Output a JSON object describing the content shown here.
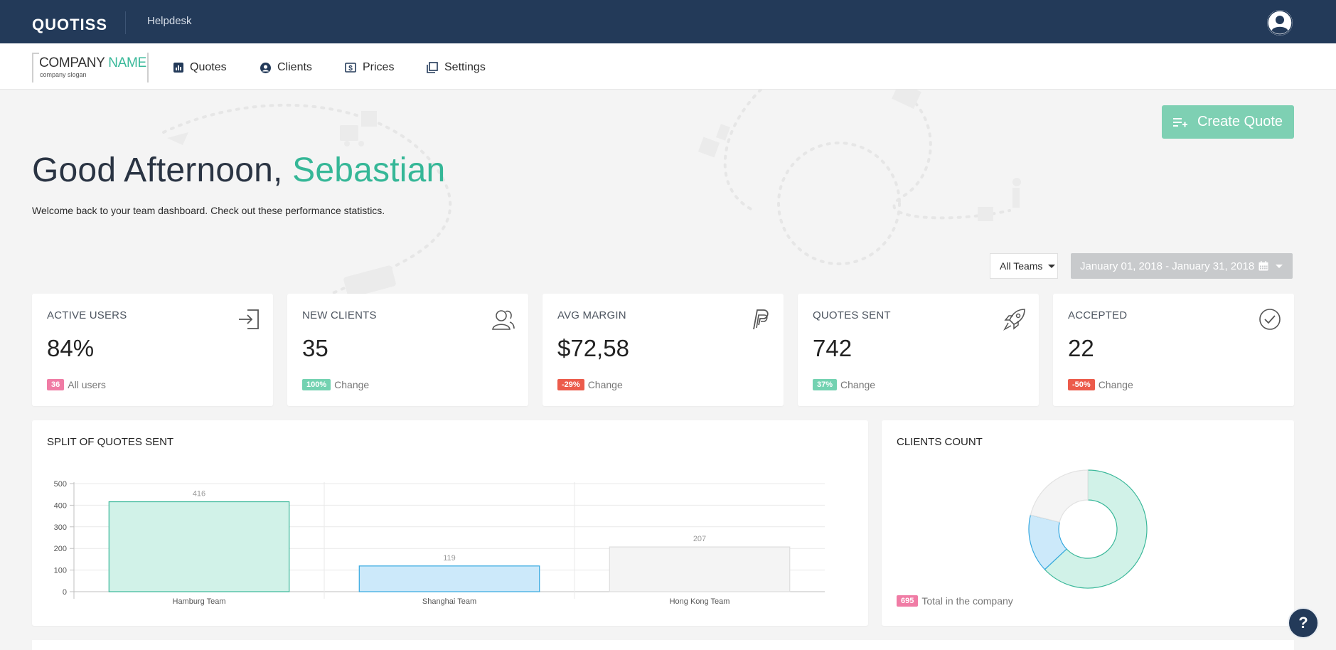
{
  "topbar": {
    "brand": "QUOTISS",
    "helpdesk": "Helpdesk"
  },
  "navbar": {
    "logo_name_part1": "COMPANY ",
    "logo_name_part2": "NAME",
    "logo_slogan": "company slogan",
    "items": [
      {
        "label": "Quotes",
        "icon": "bar-chart-icon"
      },
      {
        "label": "Clients",
        "icon": "user-circle-icon"
      },
      {
        "label": "Prices",
        "icon": "dollar-bill-icon"
      },
      {
        "label": "Settings",
        "icon": "windows-icon"
      }
    ]
  },
  "hero": {
    "create_button": "Create Quote",
    "greeting": "Good Afternoon, ",
    "user_name": "Sebastian",
    "welcome": "Welcome back to your team dashboard. Check out these performance statistics."
  },
  "filters": {
    "teams": "All Teams",
    "date_range": "January 01, 2018 - January 31, 2018"
  },
  "stats": [
    {
      "label": "ACTIVE USERS",
      "value": "84%",
      "badge": "36",
      "badge_color": "#f07ca5",
      "foot": "All users",
      "icon": "sign-in-icon"
    },
    {
      "label": "NEW CLIENTS",
      "value": "35",
      "badge": "100%",
      "badge_color": "#73d2b1",
      "foot": "Change",
      "icon": "users-icon"
    },
    {
      "label": "AVG MARGIN",
      "value": "$72,58",
      "badge": "-29%",
      "badge_color": "#ec5b4b",
      "foot": "Change",
      "icon": "paypal-icon"
    },
    {
      "label": "QUOTES SENT",
      "value": "742",
      "badge": "37%",
      "badge_color": "#73d2b1",
      "foot": "Change",
      "icon": "rocket-icon"
    },
    {
      "label": "ACCEPTED",
      "value": "22",
      "badge": "-50%",
      "badge_color": "#ec5b4b",
      "foot": "Change",
      "icon": "check-circle-icon"
    }
  ],
  "split_chart": {
    "title": "SPLIT OF QUOTES SENT"
  },
  "clients_count": {
    "title": "CLIENTS COUNT",
    "badge": "695",
    "foot": "Total in the company"
  },
  "help": "?",
  "chart_data": [
    {
      "type": "bar",
      "title": "SPLIT OF QUOTES SENT",
      "categories": [
        "Hamburg Team",
        "Shanghai Team",
        "Hong Kong Team"
      ],
      "values": [
        416,
        119,
        207
      ],
      "ylim": [
        0,
        500
      ],
      "yticks": [
        0,
        100,
        200,
        300,
        400,
        500
      ],
      "colors": {
        "fills": [
          "#d1f2e8",
          "#cce9fa",
          "#f4f4f4"
        ],
        "strokes": [
          "#3bb89a",
          "#35a8e0",
          "#dddddd"
        ]
      },
      "grid": true,
      "data_labels": true
    },
    {
      "type": "pie",
      "title": "CLIENTS COUNT",
      "donut": true,
      "values": [
        438,
        110,
        147
      ],
      "colors": {
        "fills": [
          "#d1f2e8",
          "#cce9fa",
          "#f4f4f4"
        ],
        "strokes": [
          "#3bb89a",
          "#35a8e0",
          "#e2e2e2"
        ]
      }
    }
  ]
}
